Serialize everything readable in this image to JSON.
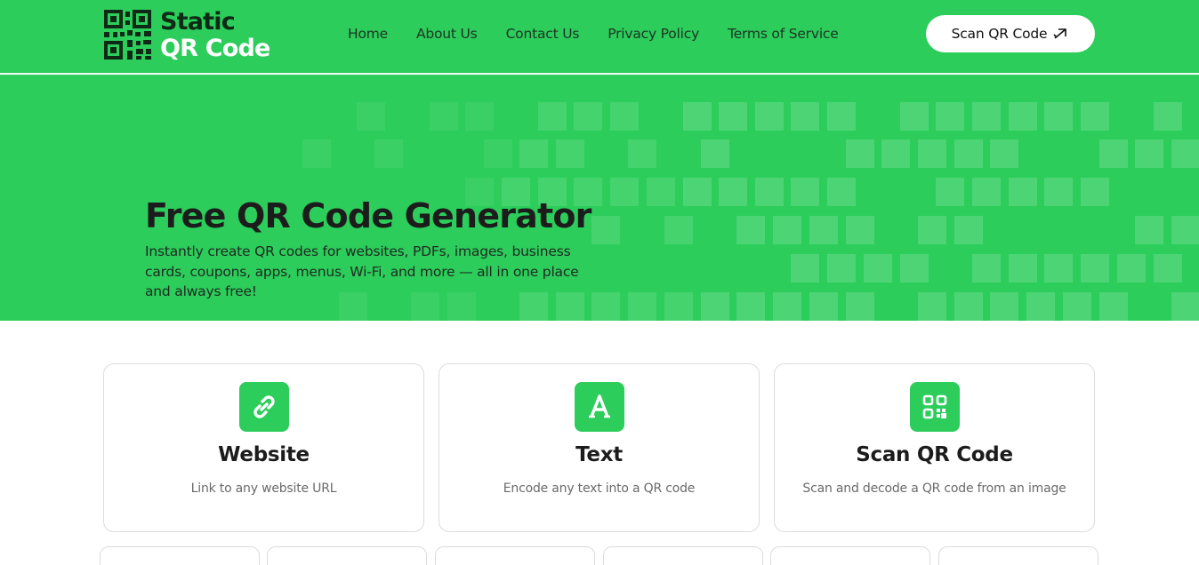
{
  "brand": {
    "line1": "Static",
    "line2": "QR Code",
    "accent": "#2ccd5b"
  },
  "nav": [
    {
      "label": "Home"
    },
    {
      "label": "About Us"
    },
    {
      "label": "Contact Us"
    },
    {
      "label": "Privacy Policy"
    },
    {
      "label": "Terms of Service"
    }
  ],
  "header_button": {
    "label": "Scan QR Code",
    "icon": "arrow-up-right-icon"
  },
  "hero": {
    "title": "Free QR Code Generator",
    "subtitle": "Instantly create QR codes for websites, PDFs, images, business cards, coupons, apps, menus, Wi-Fi, and more — all in one place and always free!"
  },
  "cards": [
    {
      "title": "Website",
      "description": "Link to any website URL",
      "icon": "link-icon"
    },
    {
      "title": "Text",
      "description": "Encode any text into a QR code",
      "icon": "text-icon"
    },
    {
      "title": "Scan QR Code",
      "description": "Scan and decode a QR code from an image",
      "icon": "qr-scan-icon"
    }
  ]
}
